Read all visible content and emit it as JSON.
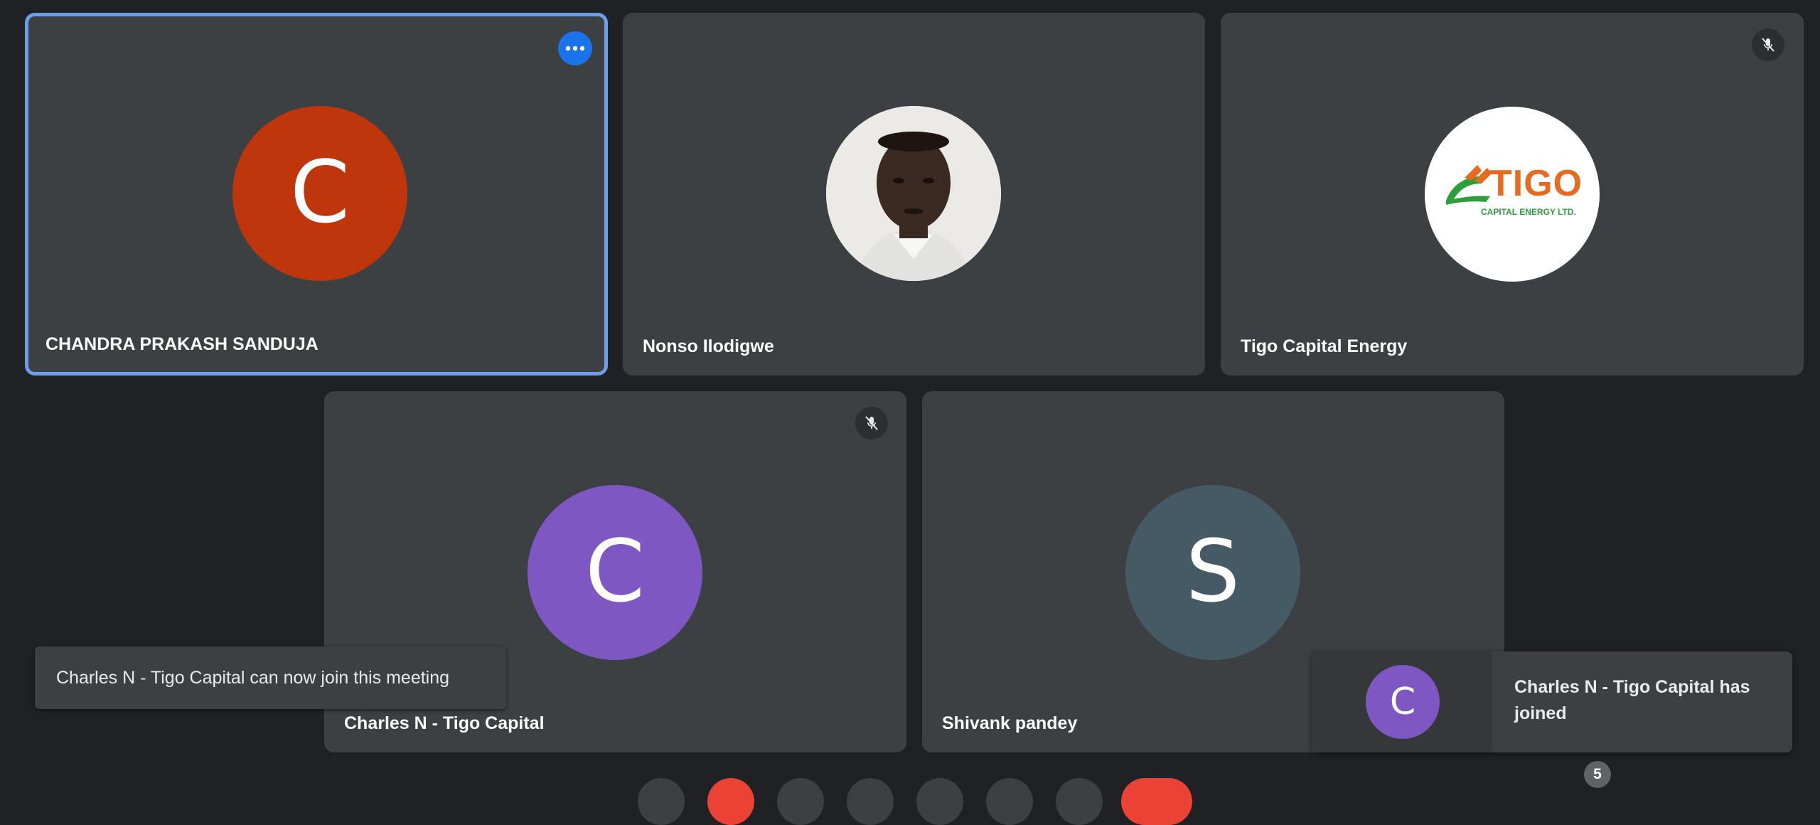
{
  "participants": [
    {
      "name": "CHANDRA PRAKASH SANDUJA",
      "initial": "C",
      "avatar_color": "#bf360c",
      "active_speaker": true,
      "muted": false
    },
    {
      "name": "Nonso Ilodigwe",
      "initial": "",
      "avatar_type": "photo",
      "muted": false
    },
    {
      "name": "Tigo Capital Energy",
      "avatar_type": "logo",
      "logo_text": "TIGO",
      "logo_subtext": "CAPITAL ENERGY LTD.",
      "muted": true
    },
    {
      "name": "Charles N - Tigo Capital",
      "initial": "C",
      "avatar_color": "#7e57c2",
      "muted": true
    },
    {
      "name": "Shivank pandey",
      "initial": "S",
      "avatar_color": "#455a64",
      "muted": false
    }
  ],
  "toast": {
    "message": "Charles N - Tigo Capital can now join this meeting"
  },
  "join_notification": {
    "initial": "C",
    "message": "Charles N - Tigo Capital has joined"
  },
  "participant_count": "5",
  "colors": {
    "background": "#202124",
    "tile": "#3c4043",
    "active_border": "#6d9eeb",
    "accent": "#1a73e8",
    "leave": "#ea4335"
  }
}
